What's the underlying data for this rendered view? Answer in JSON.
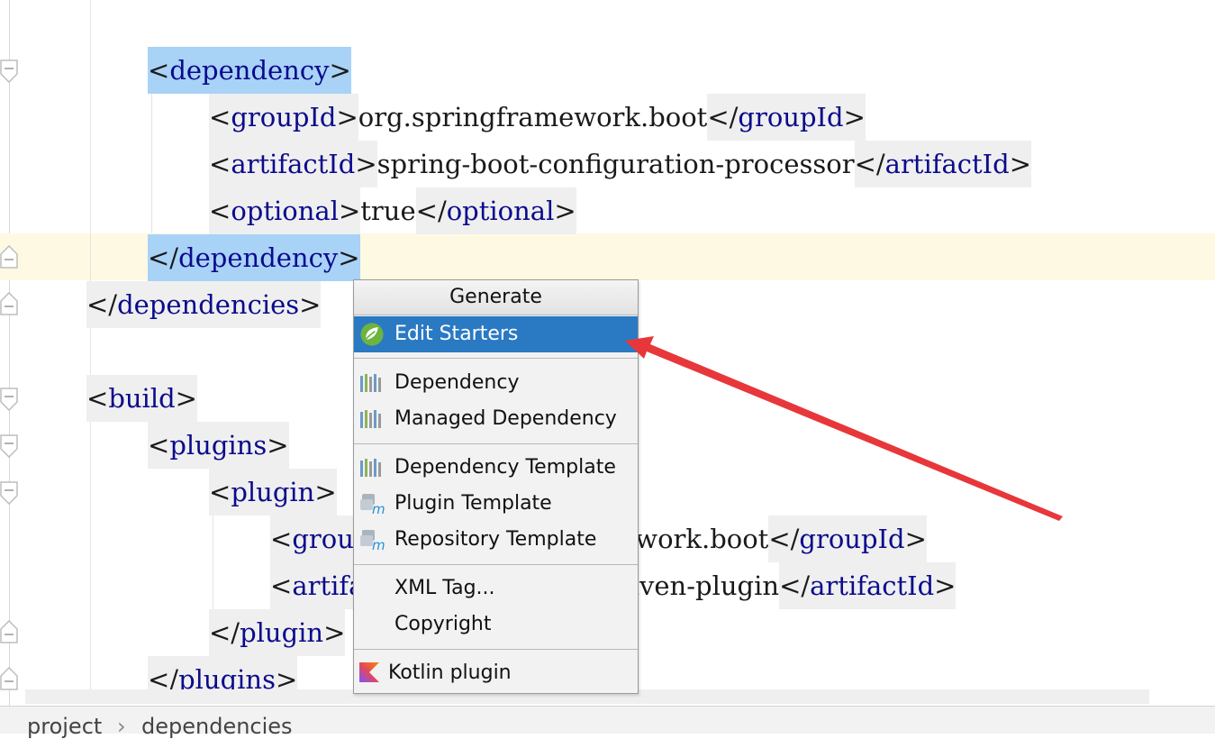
{
  "editor": {
    "lines": [
      {
        "id": "dep-open",
        "tokens": [
          {
            "k": "b",
            "t": "<"
          },
          {
            "k": "t",
            "t": "dependency"
          },
          {
            "k": "b",
            "t": ">"
          }
        ]
      },
      {
        "id": "groupid",
        "tokens": [
          {
            "k": "b",
            "t": "<"
          },
          {
            "k": "t",
            "t": "groupId"
          },
          {
            "k": "b",
            "t": ">"
          },
          {
            "k": "v",
            "t": "org.springframework.boot"
          },
          {
            "k": "b",
            "t": "</"
          },
          {
            "k": "t",
            "t": "groupId"
          },
          {
            "k": "b",
            "t": ">"
          }
        ]
      },
      {
        "id": "artifactid",
        "tokens": [
          {
            "k": "b",
            "t": "<"
          },
          {
            "k": "t",
            "t": "artifactId"
          },
          {
            "k": "b",
            "t": ">"
          },
          {
            "k": "v",
            "t": "spring-boot-configuration-processor"
          },
          {
            "k": "b",
            "t": "</"
          },
          {
            "k": "t",
            "t": "artifactId"
          },
          {
            "k": "b",
            "t": ">"
          }
        ]
      },
      {
        "id": "optional",
        "tokens": [
          {
            "k": "b",
            "t": "<"
          },
          {
            "k": "t",
            "t": "optional"
          },
          {
            "k": "b",
            "t": ">"
          },
          {
            "k": "v",
            "t": "true"
          },
          {
            "k": "b",
            "t": "</"
          },
          {
            "k": "t",
            "t": "optional"
          },
          {
            "k": "b",
            "t": ">"
          }
        ]
      },
      {
        "id": "dep-close",
        "tokens": [
          {
            "k": "b",
            "t": "</"
          },
          {
            "k": "t",
            "t": "dependency"
          },
          {
            "k": "b",
            "t": ">"
          }
        ]
      },
      {
        "id": "deps-close",
        "tokens": [
          {
            "k": "b",
            "t": "</"
          },
          {
            "k": "t",
            "t": "dependencies"
          },
          {
            "k": "b",
            "t": ">"
          }
        ]
      },
      {
        "id": "build-open",
        "tokens": [
          {
            "k": "b",
            "t": "<"
          },
          {
            "k": "t",
            "t": "build"
          },
          {
            "k": "b",
            "t": ">"
          }
        ]
      },
      {
        "id": "plugins-open",
        "tokens": [
          {
            "k": "b",
            "t": "<"
          },
          {
            "k": "t",
            "t": "plugins"
          },
          {
            "k": "b",
            "t": ">"
          }
        ]
      },
      {
        "id": "plugin-open",
        "tokens": [
          {
            "k": "b",
            "t": "<"
          },
          {
            "k": "t",
            "t": "plugin"
          },
          {
            "k": "b",
            "t": ">"
          }
        ]
      },
      {
        "id": "plugin-groupid",
        "tokens": [
          {
            "k": "b",
            "t": "<"
          },
          {
            "k": "t",
            "t": "groupId"
          },
          {
            "k": "b",
            "t": ">"
          },
          {
            "k": "v",
            "t": "org.springframework.boot"
          },
          {
            "k": "b",
            "t": "</"
          },
          {
            "k": "t",
            "t": "groupId"
          },
          {
            "k": "b",
            "t": ">"
          }
        ]
      },
      {
        "id": "plugin-artifactid",
        "tokens": [
          {
            "k": "b",
            "t": "<"
          },
          {
            "k": "t",
            "t": "artifactId"
          },
          {
            "k": "b",
            "t": ">"
          },
          {
            "k": "v",
            "t": "spring-boot-maven-plugin"
          },
          {
            "k": "b",
            "t": "</"
          },
          {
            "k": "t",
            "t": "artifactId"
          },
          {
            "k": "b",
            "t": ">"
          }
        ]
      },
      {
        "id": "plugin-close",
        "tokens": [
          {
            "k": "b",
            "t": "</"
          },
          {
            "k": "t",
            "t": "plugin"
          },
          {
            "k": "b",
            "t": ">"
          }
        ]
      },
      {
        "id": "plugins-close",
        "tokens": [
          {
            "k": "b",
            "t": "</"
          },
          {
            "k": "t",
            "t": "plugins"
          },
          {
            "k": "b",
            "t": ">"
          }
        ]
      }
    ]
  },
  "breadcrumb": {
    "items": [
      "project",
      "dependencies"
    ],
    "separator": "›"
  },
  "popup": {
    "title": "Generate",
    "items": [
      {
        "label": "Edit Starters",
        "icon": "spring-leaf-icon",
        "selected": true
      },
      {
        "label": "Dependency",
        "icon": "maven-bars-icon"
      },
      {
        "label": "Managed Dependency",
        "icon": "maven-bars-icon"
      },
      {
        "label": "Dependency Template",
        "icon": "maven-bars-icon"
      },
      {
        "label": "Plugin Template",
        "icon": "maven-template-icon"
      },
      {
        "label": "Repository Template",
        "icon": "maven-template-icon"
      },
      {
        "label": "XML Tag...",
        "icon": ""
      },
      {
        "label": "Copyright",
        "icon": ""
      },
      {
        "label": "Kotlin plugin",
        "icon": "kotlin-icon"
      }
    ]
  },
  "colors": {
    "tag": "#0b0b8c",
    "selection": "#a9d2f7",
    "current_line": "#fdf9e3",
    "menu_selected": "#2a79c3",
    "annotation_arrow": "#e8373a"
  }
}
